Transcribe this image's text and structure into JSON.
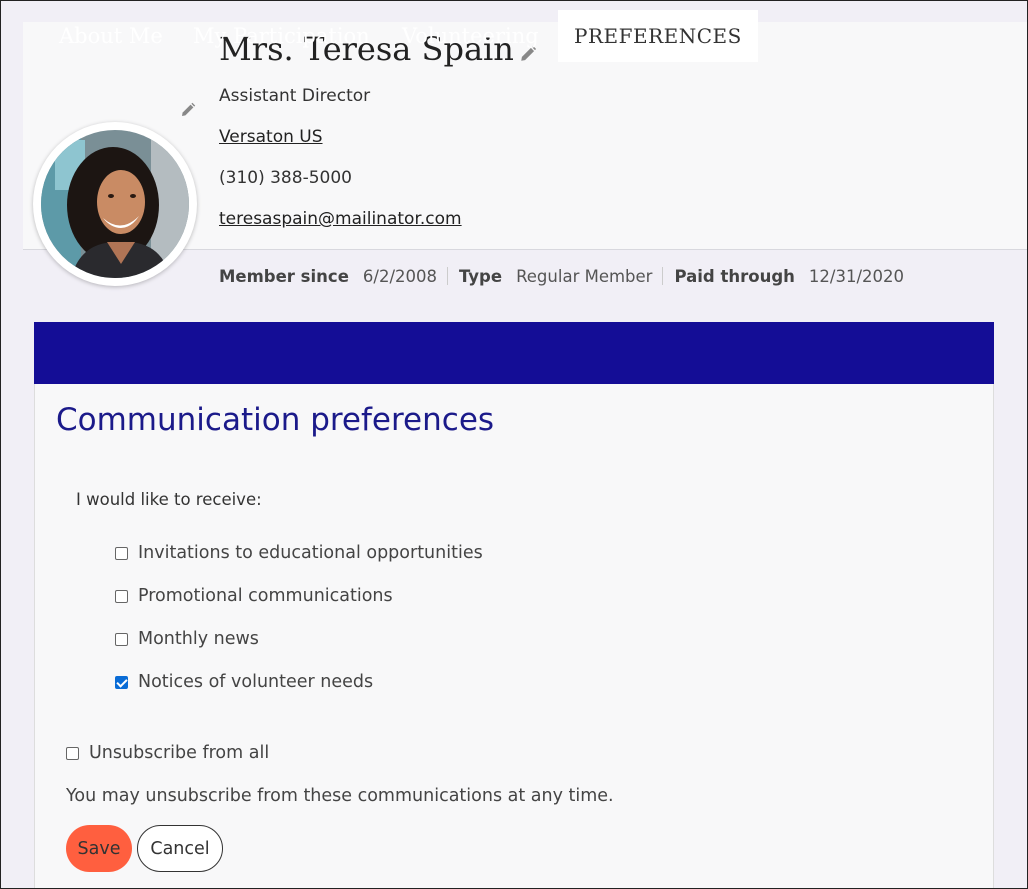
{
  "profile": {
    "name": "Mrs. Teresa Spain",
    "title": "Assistant Director",
    "company": "Versaton US",
    "phone": "(310) 388-5000",
    "email": "teresaspain@mailinator.com"
  },
  "membership": {
    "member_since_label": "Member since",
    "member_since_value": "6/2/2008",
    "type_label": "Type",
    "type_value": "Regular Member",
    "paid_through_label": "Paid through",
    "paid_through_value": "12/31/2020"
  },
  "tabs": [
    {
      "label": "About Me",
      "active": false
    },
    {
      "label": "My Participation",
      "active": false
    },
    {
      "label": "Volunteering",
      "active": false
    },
    {
      "label": "PREFERENCES",
      "active": true
    }
  ],
  "preferences": {
    "heading": "Communication preferences",
    "intro": "I would like to receive:",
    "options": [
      {
        "label": "Invitations to educational opportunities",
        "checked": false
      },
      {
        "label": "Promotional communications",
        "checked": false
      },
      {
        "label": "Monthly news",
        "checked": false
      },
      {
        "label": "Notices of volunteer needs",
        "checked": true
      }
    ],
    "unsubscribe": {
      "label": "Unsubscribe from all",
      "checked": false
    },
    "note": "You may unsubscribe from these communications at any time.",
    "save_label": "Save",
    "cancel_label": "Cancel"
  },
  "colors": {
    "tab_bar": "#140d96",
    "heading": "#1b1a8a",
    "save_button": "#ff5f3f",
    "checkbox_checked": "#0a6cd6"
  },
  "icons": {
    "edit": "pencil-icon"
  }
}
